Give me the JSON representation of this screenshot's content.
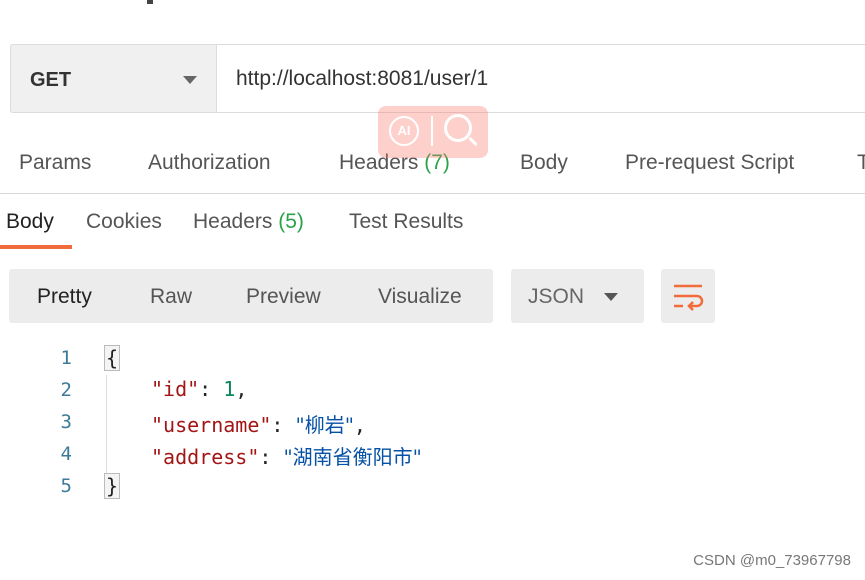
{
  "request": {
    "method": "GET",
    "url": "http://localhost:8081/user/1"
  },
  "request_tabs": [
    {
      "label": "Params"
    },
    {
      "label": "Authorization"
    },
    {
      "label": "Headers",
      "count": "(7)"
    },
    {
      "label": "Body"
    },
    {
      "label": "Pre-request Script"
    },
    {
      "label": "T"
    }
  ],
  "response_tabs": [
    {
      "label": "Body",
      "active": true
    },
    {
      "label": "Cookies"
    },
    {
      "label": "Headers",
      "count": "(5)"
    },
    {
      "label": "Test Results"
    }
  ],
  "view_modes": [
    "Pretty",
    "Raw",
    "Preview",
    "Visualize"
  ],
  "active_view": "Pretty",
  "format": "JSON",
  "overlay": {
    "ai_label": "AI"
  },
  "code": {
    "line_numbers": [
      "1",
      "2",
      "3",
      "4",
      "5"
    ],
    "open_brace": "{",
    "close_brace": "}",
    "entries": [
      {
        "key": "\"id\"",
        "value": "1",
        "type": "number",
        "trailing": ","
      },
      {
        "key": "\"username\"",
        "value": "\"柳岩\"",
        "type": "string",
        "trailing": ","
      },
      {
        "key": "\"address\"",
        "value": "\"湖南省衡阳市\"",
        "type": "string",
        "trailing": ""
      }
    ]
  },
  "watermark": "CSDN @m0_73967798",
  "colors": {
    "accent": "#f26b3a",
    "count_green": "#2aa24a",
    "json_key": "#a31515",
    "json_string": "#0451a5",
    "json_number": "#098658",
    "line_number": "#3d7a9a"
  },
  "icons": {
    "method_dropdown": "chevron-down-icon",
    "format_dropdown": "chevron-down-icon",
    "wrap": "wrap-lines-icon",
    "ai": "ai-icon",
    "search": "search-icon"
  }
}
